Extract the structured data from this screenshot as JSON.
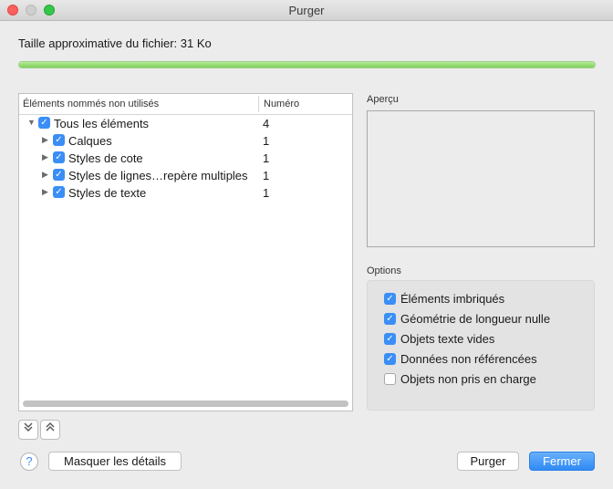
{
  "window": {
    "title": "Purger"
  },
  "file_size": {
    "label": "Taille approximative du fichier: 31 Ko",
    "progress_percent": 100
  },
  "tree": {
    "columns": [
      "Éléments nommés non utilisés",
      "Numéro"
    ],
    "rows": [
      {
        "label": "Tous les éléments",
        "count": "4",
        "checked": true,
        "level": 0,
        "expanded": true
      },
      {
        "label": "Calques",
        "count": "1",
        "checked": true,
        "level": 1
      },
      {
        "label": "Styles de cote",
        "count": "1",
        "checked": true,
        "level": 1
      },
      {
        "label": "Styles de lignes…repère multiples",
        "count": "1",
        "checked": true,
        "level": 1
      },
      {
        "label": "Styles de texte",
        "count": "1",
        "checked": true,
        "level": 1
      }
    ]
  },
  "preview": {
    "label": "Aperçu"
  },
  "options": {
    "label": "Options",
    "items": [
      {
        "label": "Éléments imbriqués",
        "checked": true
      },
      {
        "label": "Géométrie de longueur nulle",
        "checked": true
      },
      {
        "label": "Objets texte vides",
        "checked": true
      },
      {
        "label": "Données non référencées",
        "checked": true
      },
      {
        "label": "Objets non pris en charge",
        "checked": false
      }
    ]
  },
  "icons": {
    "expand": "double-chevron-down-icon",
    "collapse": "double-chevron-up-icon",
    "help": "question-mark-icon",
    "help_glyph": "?"
  },
  "buttons": {
    "details": "Masquer les détails",
    "purge": "Purger",
    "close": "Fermer"
  },
  "colors": {
    "accent": "#3a8ef6",
    "progress": "#7fd05a"
  }
}
